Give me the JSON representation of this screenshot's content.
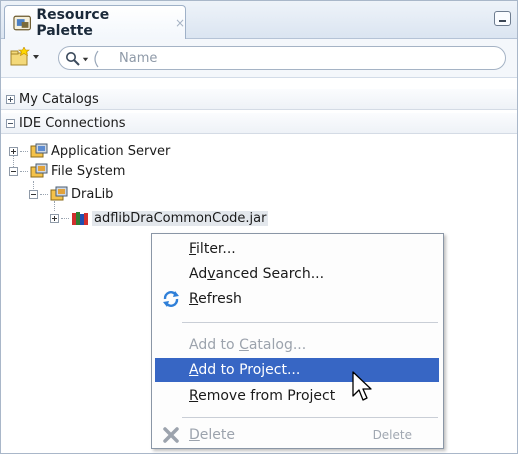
{
  "panel": {
    "title": "Resource Palette",
    "close_glyph": "×"
  },
  "toolbar": {
    "search_placeholder": "Name"
  },
  "sections": {
    "my_catalogs": "My Catalogs",
    "ide_connections": "IDE Connections"
  },
  "tree": {
    "application_server": "Application Server",
    "file_system": "File System",
    "dralib": "DraLib",
    "jar": "adflibDraCommonCode.jar"
  },
  "context_menu": {
    "filter": {
      "pre": "",
      "acc": "F",
      "post": "ilter..."
    },
    "advanced_search": {
      "pre": "Ad",
      "acc": "v",
      "post": "anced Search..."
    },
    "refresh": {
      "pre": "",
      "acc": "R",
      "post": "efresh"
    },
    "add_to_catalog": {
      "pre": "Add to ",
      "acc": "C",
      "post": "atalog..."
    },
    "add_to_project": {
      "pre": "",
      "acc": "A",
      "post": "dd to Project..."
    },
    "remove_from_project": {
      "pre": "",
      "acc": "R",
      "post": "emove from Project"
    },
    "delete": {
      "pre": "",
      "acc": "D",
      "post": "elete",
      "shortcut": "Delete"
    }
  },
  "icons": {
    "tab": "resource-palette-icon",
    "new": "new-catalog-icon",
    "search": "magnifier-icon",
    "refresh": "refresh-icon",
    "delete": "delete-x-icon",
    "cursor": "mouse-pointer-icon"
  },
  "colors": {
    "highlight": "#3766c4",
    "disabled_text": "#9ca3ad"
  }
}
